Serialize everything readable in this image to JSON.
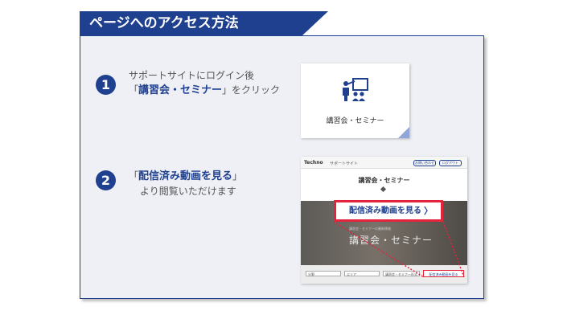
{
  "header": {
    "title": "ページへのアクセス方法"
  },
  "steps": [
    {
      "number": "1",
      "line1": "サポートサイトにログイン後",
      "bracket_open": "「",
      "highlight": "講習会・セミナー",
      "bracket_close": "」",
      "suffix": "をクリック"
    },
    {
      "number": "2",
      "bracket_open": "「",
      "highlight": "配信済み動画を見る",
      "bracket_close": "」",
      "line2": "より閲覧いただけます"
    }
  ],
  "card": {
    "label": "講習会・セミナー",
    "icon": "seminar-lecture-icon"
  },
  "screenshot": {
    "logo": "Techno",
    "site_name": "サポートサイト",
    "header_pills": [
      "お問い合わせ",
      "ログアウト"
    ],
    "page_title": "講習会・セミナー",
    "hero_text": "講習会・セミナー",
    "hero_subtext": "講習会・セミナーの最新情報",
    "selects": [
      "分野",
      "エリア",
      "講習会・セミナー形式"
    ],
    "small_button": "配信済み動画を見る"
  },
  "callout": {
    "label": "配信済み動画を見る",
    "chevron": "〉"
  },
  "colors": {
    "brand": "#1f3f8f",
    "accent": "#e4233d",
    "panel": "#eef0f5"
  }
}
